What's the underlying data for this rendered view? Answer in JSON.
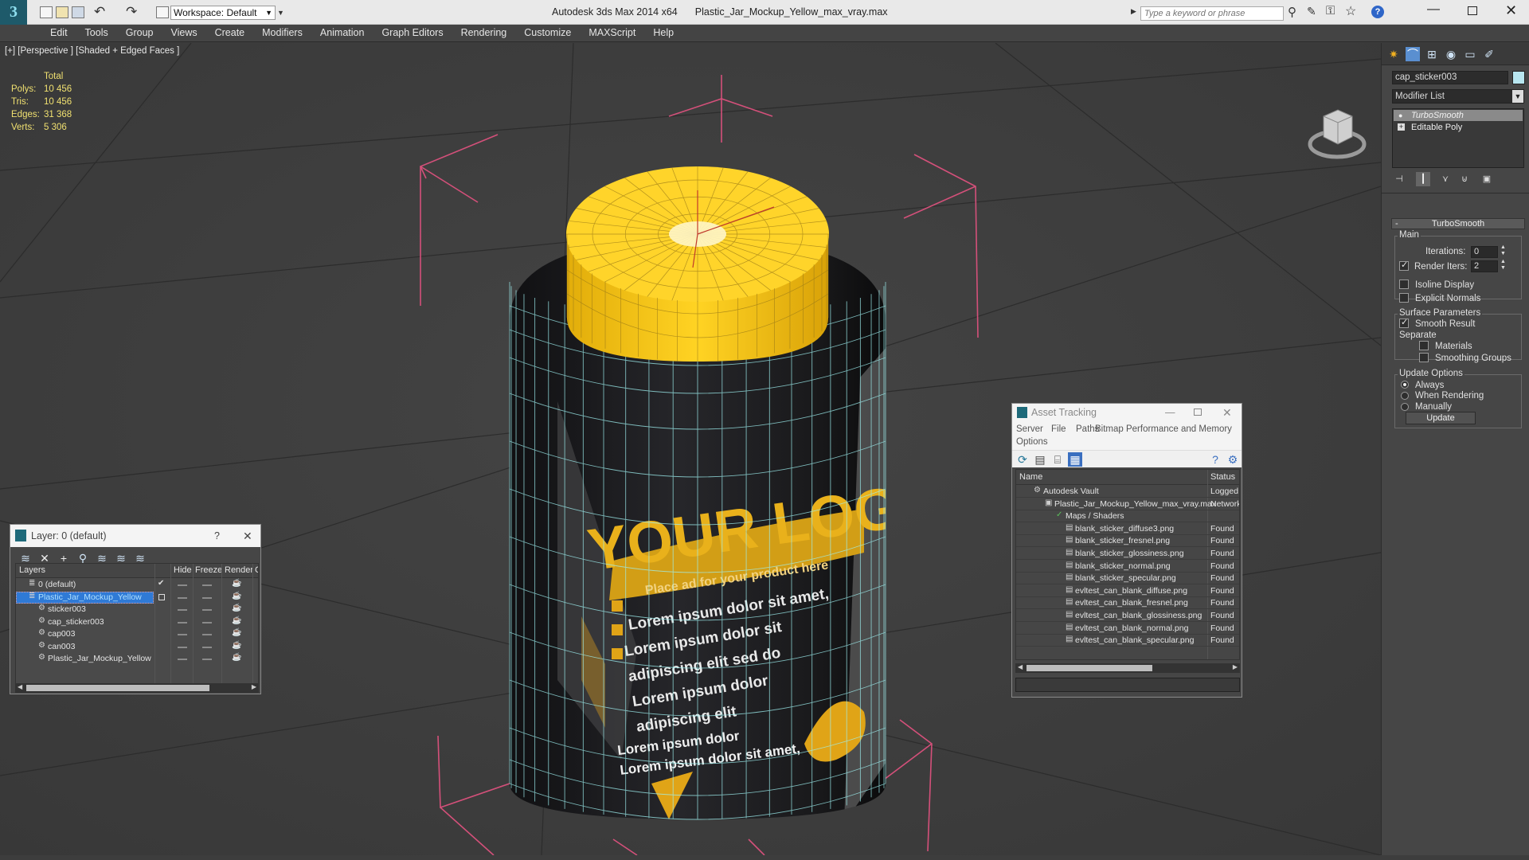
{
  "app": {
    "title_app": "Autodesk 3ds Max  2014 x64",
    "title_file": "Plastic_Jar_Mockup_Yellow_max_vray.max",
    "workspace_label": "Workspace: Default",
    "search_placeholder": "Type a keyword or phrase"
  },
  "menu": [
    "Edit",
    "Tools",
    "Group",
    "Views",
    "Create",
    "Modifiers",
    "Animation",
    "Graph Editors",
    "Rendering",
    "Customize",
    "MAXScript",
    "Help"
  ],
  "viewport": {
    "label": "[+] [Perspective ] [Shaded + Edged Faces ]",
    "stats_header": "Total",
    "stats": [
      {
        "k": "Polys:",
        "v": "10 456"
      },
      {
        "k": "Tris:",
        "v": "10 456"
      },
      {
        "k": "Edges:",
        "v": "31 368"
      },
      {
        "k": "Verts:",
        "v": "5 306"
      }
    ],
    "label_big": "YOUR LOG",
    "label_sub": "Place ad for your product here",
    "label_lines": [
      "Lorem ipsum dolor sit amet,",
      "Lorem ipsum dolor sit",
      "adipiscing elit sed do",
      "Lorem ipsum dolor",
      "adipiscing elit"
    ],
    "label_small": [
      "Lorem ipsum dolor",
      "Lorem ipsum dolor sit amet,"
    ],
    "colors": {
      "cap": "#f3c21a",
      "body": "#1c1c1e",
      "wire": "#9ef0f0",
      "bbox": "#d4507a"
    }
  },
  "command_panel": {
    "object_name": "cap_sticker003",
    "modifier_list": "Modifier List",
    "stack": [
      "TurboSmooth",
      "Editable Poly"
    ],
    "rollout_title": "TurboSmooth",
    "main_label": "Main",
    "iterations_label": "Iterations:",
    "iterations_value": "0",
    "render_iters_label": "Render Iters:",
    "render_iters_value": "2",
    "isoline_label": "Isoline Display",
    "explicit_normals_label": "Explicit Normals",
    "surface_params_label": "Surface Parameters",
    "smooth_result_label": "Smooth Result",
    "separate_label": "Separate",
    "materials_label": "Materials",
    "smoothing_groups_label": "Smoothing Groups",
    "update_options_label": "Update Options",
    "always_label": "Always",
    "when_rendering_label": "When Rendering",
    "manually_label": "Manually",
    "update_button": "Update"
  },
  "layer_window": {
    "title": "Layer: 0 (default)",
    "help": "?",
    "columns": {
      "layers": "Layers",
      "hide": "Hide",
      "freeze": "Freeze",
      "render": "Render",
      "c": "C"
    },
    "rows": [
      {
        "name": "0 (default)"
      },
      {
        "name": "Plastic_Jar_Mockup_Yellow"
      },
      {
        "name": "sticker003"
      },
      {
        "name": "cap_sticker003"
      },
      {
        "name": "cap003"
      },
      {
        "name": "can003"
      },
      {
        "name": "Plastic_Jar_Mockup_Yellow"
      }
    ]
  },
  "asset_window": {
    "title": "Asset Tracking",
    "menu": [
      "Server",
      "File",
      "Paths",
      "Bitmap Performance and Memory"
    ],
    "menu2": "Options",
    "columns": {
      "name": "Name",
      "status": "Status"
    },
    "rows": [
      {
        "name": "Autodesk Vault",
        "status": "Logged ("
      },
      {
        "name": "Plastic_Jar_Mockup_Yellow_max_vray.max",
        "status": "Network"
      },
      {
        "name": "Maps / Shaders",
        "status": ""
      },
      {
        "name": "blank_sticker_diffuse3.png",
        "status": "Found"
      },
      {
        "name": "blank_sticker_fresnel.png",
        "status": "Found"
      },
      {
        "name": "blank_sticker_glossiness.png",
        "status": "Found"
      },
      {
        "name": "blank_sticker_normal.png",
        "status": "Found"
      },
      {
        "name": "blank_sticker_specular.png",
        "status": "Found"
      },
      {
        "name": "evltest_can_blank_diffuse.png",
        "status": "Found"
      },
      {
        "name": "evltest_can_blank_fresnel.png",
        "status": "Found"
      },
      {
        "name": "evltest_can_blank_glossiness.png",
        "status": "Found"
      },
      {
        "name": "evltest_can_blank_normal.png",
        "status": "Found"
      },
      {
        "name": "evltest_can_blank_specular.png",
        "status": "Found"
      }
    ]
  }
}
